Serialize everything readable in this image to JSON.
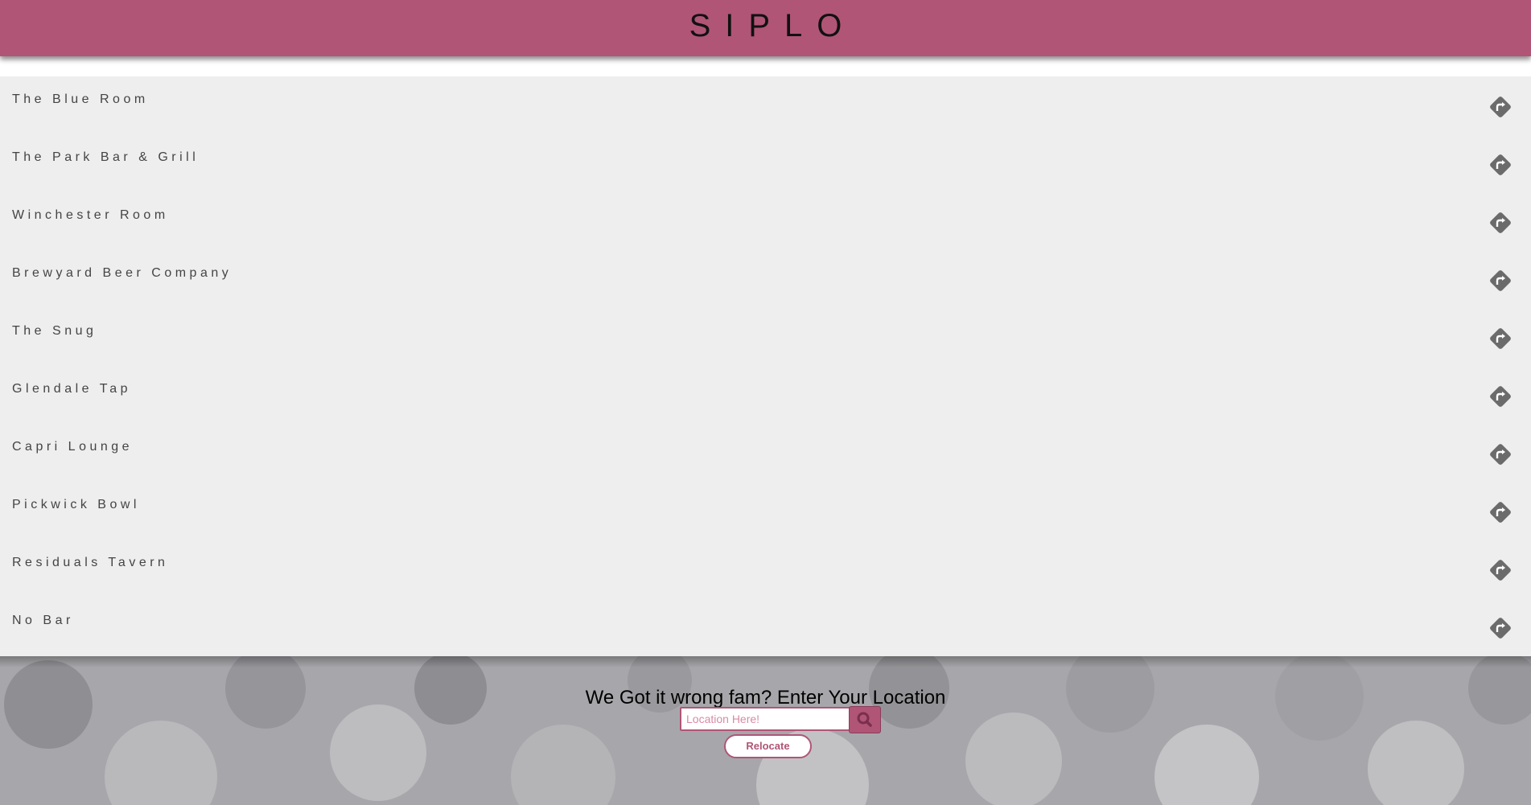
{
  "header": {
    "title": "SIPLO",
    "color": "#b05576"
  },
  "bars": [
    {
      "name": "The Blue Room",
      "icon": "directions-icon"
    },
    {
      "name": "The Park Bar & Grill",
      "icon": "directions-icon"
    },
    {
      "name": "Winchester Room",
      "icon": "directions-icon"
    },
    {
      "name": "Brewyard Beer Company",
      "icon": "directions-icon"
    },
    {
      "name": "The Snug",
      "icon": "directions-icon"
    },
    {
      "name": "Glendale Tap",
      "icon": "directions-icon"
    },
    {
      "name": "Capri Lounge",
      "icon": "directions-icon"
    },
    {
      "name": "Pickwick Bowl",
      "icon": "directions-icon"
    },
    {
      "name": "Residuals Tavern",
      "icon": "directions-icon"
    },
    {
      "name": "No Bar",
      "icon": "directions-icon"
    }
  ],
  "relocate": {
    "prompt": "We Got it wrong fam? Enter Your Location",
    "input_placeholder": "Location Here!",
    "input_value": "",
    "search_icon": "search-icon",
    "button_label": "Relocate"
  }
}
